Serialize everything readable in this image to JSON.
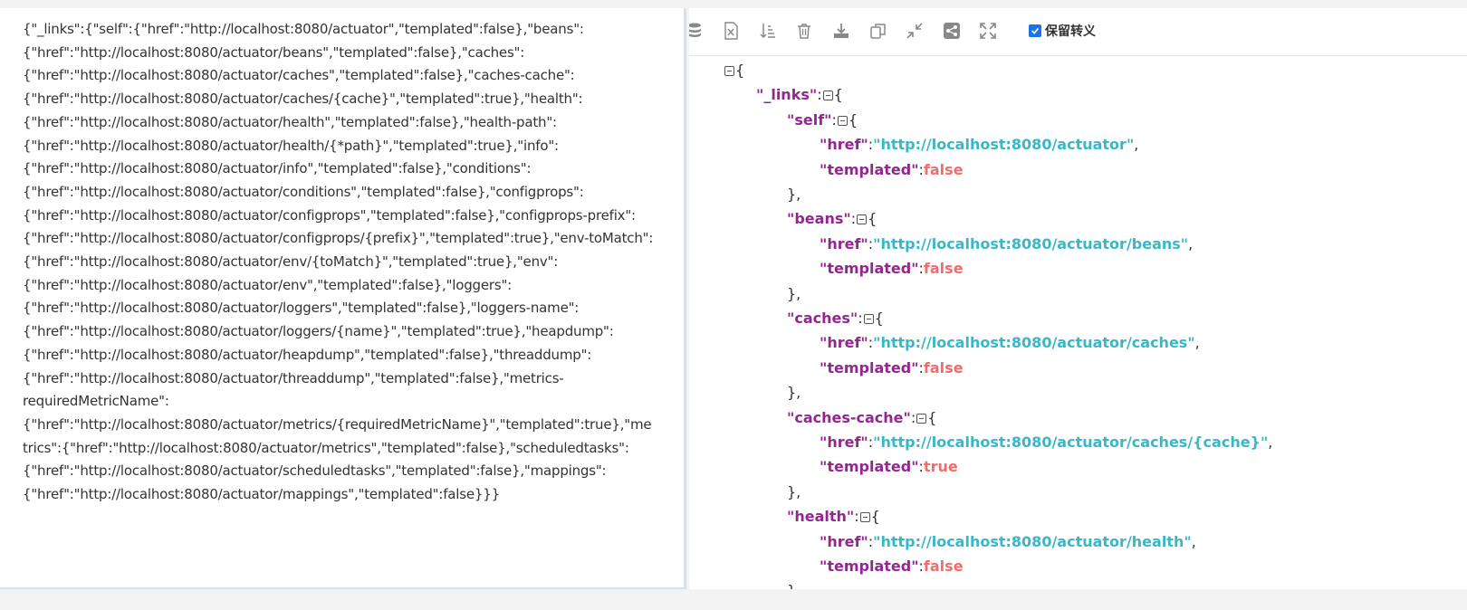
{
  "raw_json_lines": [
    "{\"_links\":{\"self\":{\"href\":\"http://localhost:8080/actuator\",\"templated\":false},\"beans\":",
    "{\"href\":\"http://localhost:8080/actuator/beans\",\"templated\":false},\"caches\":",
    "{\"href\":\"http://localhost:8080/actuator/caches\",\"templated\":false},\"caches-cache\":",
    "{\"href\":\"http://localhost:8080/actuator/caches/{cache}\",\"templated\":true},\"health\":",
    "{\"href\":\"http://localhost:8080/actuator/health\",\"templated\":false},\"health-path\":",
    "{\"href\":\"http://localhost:8080/actuator/health/{*path}\",\"templated\":true},\"info\":",
    "{\"href\":\"http://localhost:8080/actuator/info\",\"templated\":false},\"conditions\":",
    "{\"href\":\"http://localhost:8080/actuator/conditions\",\"templated\":false},\"configprops\":",
    "{\"href\":\"http://localhost:8080/actuator/configprops\",\"templated\":false},\"configprops-prefix\":",
    "{\"href\":\"http://localhost:8080/actuator/configprops/{prefix}\",\"templated\":true},\"env-toMatch\":",
    "{\"href\":\"http://localhost:8080/actuator/env/{toMatch}\",\"templated\":true},\"env\":",
    "{\"href\":\"http://localhost:8080/actuator/env\",\"templated\":false},\"loggers\":",
    "{\"href\":\"http://localhost:8080/actuator/loggers\",\"templated\":false},\"loggers-name\":",
    "{\"href\":\"http://localhost:8080/actuator/loggers/{name}\",\"templated\":true},\"heapdump\":",
    "{\"href\":\"http://localhost:8080/actuator/heapdump\",\"templated\":false},\"threaddump\":",
    "{\"href\":\"http://localhost:8080/actuator/threaddump\",\"templated\":false},\"metrics-",
    "requiredMetricName\":",
    "{\"href\":\"http://localhost:8080/actuator/metrics/{requiredMetricName}\",\"templated\":true},\"me",
    "trics\":{\"href\":\"http://localhost:8080/actuator/metrics\",\"templated\":false},\"scheduledtasks\":",
    "{\"href\":\"http://localhost:8080/actuator/scheduledtasks\",\"templated\":false},\"mappings\":",
    "{\"href\":\"http://localhost:8080/actuator/mappings\",\"templated\":false}}}"
  ],
  "toolbar": {
    "icons": [
      "database-icon",
      "excel-icon",
      "sort-icon",
      "trash-icon",
      "download-icon",
      "copy-icon",
      "collapse-icon",
      "share-icon",
      "expand-icon"
    ],
    "keep_escape_label": "保留转义",
    "keep_escape_checked": true
  },
  "tree": {
    "root_open": "{",
    "links_key": "\"_links\"",
    "colon": ":",
    "open_brace": "{",
    "close_brace_comma": "},",
    "comma": ",",
    "href_key": "\"href\"",
    "templated_key": "\"templated\"",
    "entries": [
      {
        "key": "\"self\"",
        "href": "\"http://localhost:8080/actuator\"",
        "templated": "false"
      },
      {
        "key": "\"beans\"",
        "href": "\"http://localhost:8080/actuator/beans\"",
        "templated": "false"
      },
      {
        "key": "\"caches\"",
        "href": "\"http://localhost:8080/actuator/caches\"",
        "templated": "false"
      },
      {
        "key": "\"caches-cache\"",
        "href": "\"http://localhost:8080/actuator/caches/{cache}\"",
        "templated": "true"
      },
      {
        "key": "\"health\"",
        "href": "\"http://localhost:8080/actuator/health\"",
        "templated": "false"
      }
    ],
    "partial_close": "},"
  },
  "colors": {
    "key": "#92278f",
    "string": "#3ab7c7",
    "boolean": "#f16d6d",
    "checkbox": "#1a73e8"
  }
}
